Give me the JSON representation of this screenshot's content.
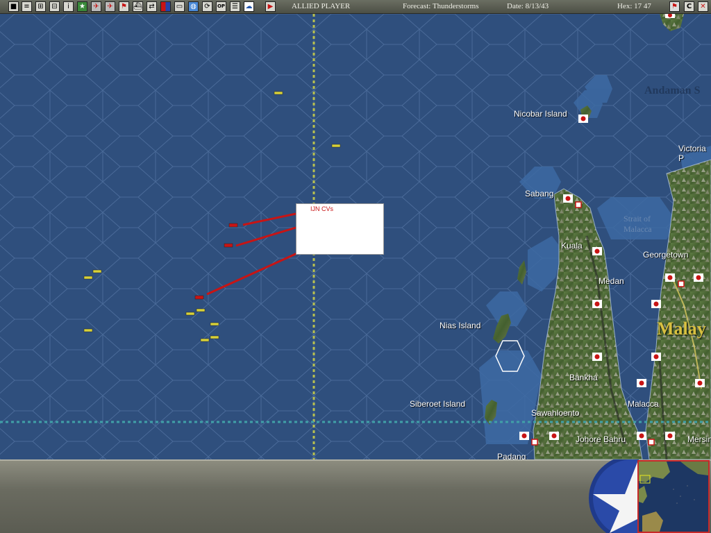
{
  "toolbar": {
    "side": "ALLIED PLAYER",
    "forecast": "Forecast: Thunderstorms",
    "date": "Date: 8/13/43",
    "hex": "Hex: 17 47",
    "right_buttons": [
      "C"
    ],
    "op_label": "OP"
  },
  "map": {
    "locations": [
      {
        "id": "andaman",
        "label": "Andaman S"
      },
      {
        "id": "nicobar",
        "label": "Nicobar Island"
      },
      {
        "id": "victoria",
        "label": "Victoria P"
      },
      {
        "id": "sabang",
        "label": "Sabang"
      },
      {
        "id": "strait",
        "label": "Strait of Malacca"
      },
      {
        "id": "kuala",
        "label": "Kuala"
      },
      {
        "id": "georgetown",
        "label": "Georgetown"
      },
      {
        "id": "medan",
        "label": "Medan"
      },
      {
        "id": "malaya",
        "label": "Malay"
      },
      {
        "id": "nias",
        "label": "Nias Island"
      },
      {
        "id": "bankha",
        "label": "Bankha"
      },
      {
        "id": "siberoet",
        "label": "Siberoet Island"
      },
      {
        "id": "malacca",
        "label": "Malacca"
      },
      {
        "id": "sawahloento",
        "label": "Sawahloento"
      },
      {
        "id": "johore",
        "label": "Johore Bahru"
      },
      {
        "id": "mersing",
        "label": "Mersin"
      },
      {
        "id": "padang",
        "label": "Padang"
      }
    ]
  },
  "popup": {
    "title": "IJN CVs"
  },
  "colors": {
    "sea": "#2f4f7d",
    "grid": "#3e5f8f",
    "land": "#4d6a3a",
    "japan": "#c81414",
    "allied_ship": "#d8d23a"
  }
}
